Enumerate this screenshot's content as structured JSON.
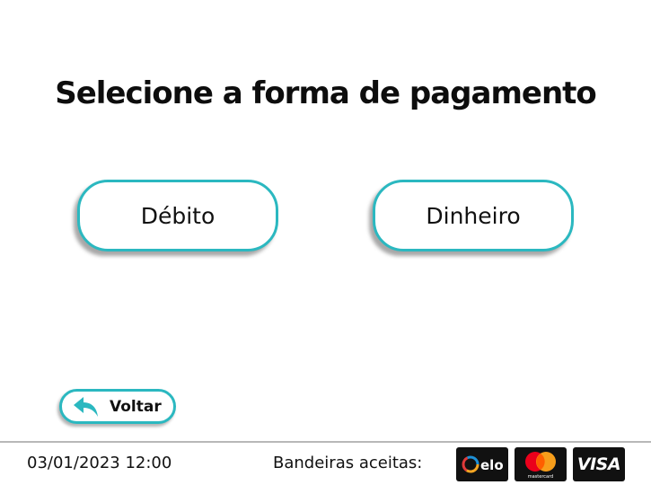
{
  "title": "Selecione a forma de pagamento",
  "payment_options": [
    {
      "label": "Débito"
    },
    {
      "label": "Dinheiro"
    }
  ],
  "back_button": {
    "label": "Voltar",
    "icon": "reply-arrow-icon"
  },
  "footer": {
    "datetime": "03/01/2023 12:00",
    "brands_label": "Bandeiras aceitas:",
    "brands": [
      {
        "name": "elo",
        "icon": "elo-logo"
      },
      {
        "name": "mastercard",
        "icon": "mastercard-logo"
      },
      {
        "name": "VISA",
        "icon": "visa-logo"
      }
    ]
  },
  "colors": {
    "accent": "#2bb8c0",
    "text": "#111111",
    "card_bg": "#111111"
  }
}
